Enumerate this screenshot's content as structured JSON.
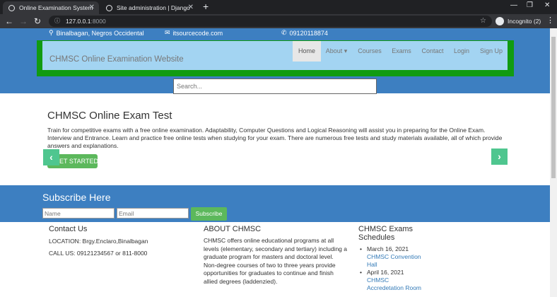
{
  "browser": {
    "tabs": [
      {
        "title": "Online Examination System",
        "active": true
      },
      {
        "title": "Site administration | Django site",
        "active": false
      }
    ],
    "new_tab_label": "+",
    "url_host": "127.0.0.1",
    "url_port": ":8000",
    "incognito_label": "Incognito (2)"
  },
  "topbar": {
    "location": "Binalbagan, Negros Occidental",
    "email": "itsourcecode.com",
    "phone": "09120118874"
  },
  "navbar": {
    "brand": "CHMSC Online Examination Website",
    "links": [
      "Home",
      "About ▾",
      "Courses",
      "Exams",
      "Contact",
      "Login",
      "Sign Up"
    ],
    "active_link": "Home"
  },
  "search": {
    "placeholder": "Search..."
  },
  "carousel": {
    "title": "CHMSC Online Exam Test",
    "text": "Train for competitive exams with a free online examination. Adaptability, Computer Questions and Logical Reasoning will assist you in preparing for the Online Exam. Interview and Entrance. Learn and practice free online tests when studying for your exam. There are numerous free tests and study materials available, all of which provide answers and explanations.",
    "cta_label": "GET STARTED",
    "prev_glyph": "‹",
    "next_glyph": "›"
  },
  "subscribe": {
    "title": "Subscribe Here",
    "name_placeholder": "Name",
    "email_placeholder": "Email",
    "button_label": "Subscribe"
  },
  "footer": {
    "contact": {
      "title": "Contact Us",
      "location": "LOCATION: Brgy.Enclaro,Binalbagan",
      "call": "CALL US: 09121234567 or 811-8000"
    },
    "about": {
      "title": "ABOUT CHMSC",
      "text": "CHMSC offers online educational programs at all levels (elementary, secondary and tertiary) including a graduate program for masters and doctoral level. Non-degree courses of two to three years provide opportunities for graduates to continue and finish allied degrees (laddenzied)."
    },
    "schedules": {
      "title": "CHMSC Exams Schedules",
      "items": [
        {
          "date": "March 16, 2021",
          "place": "CHMSC Convention Hall"
        },
        {
          "date": "April 16, 2021",
          "place": "CHMSC Accredetation Room"
        }
      ]
    }
  },
  "colors": {
    "primary_blue": "#3d7fc1",
    "nav_green": "#119b11",
    "nav_light_blue": "#a3d4f2",
    "button_green": "#5cb85c",
    "arrow_teal": "#4fc68f"
  }
}
